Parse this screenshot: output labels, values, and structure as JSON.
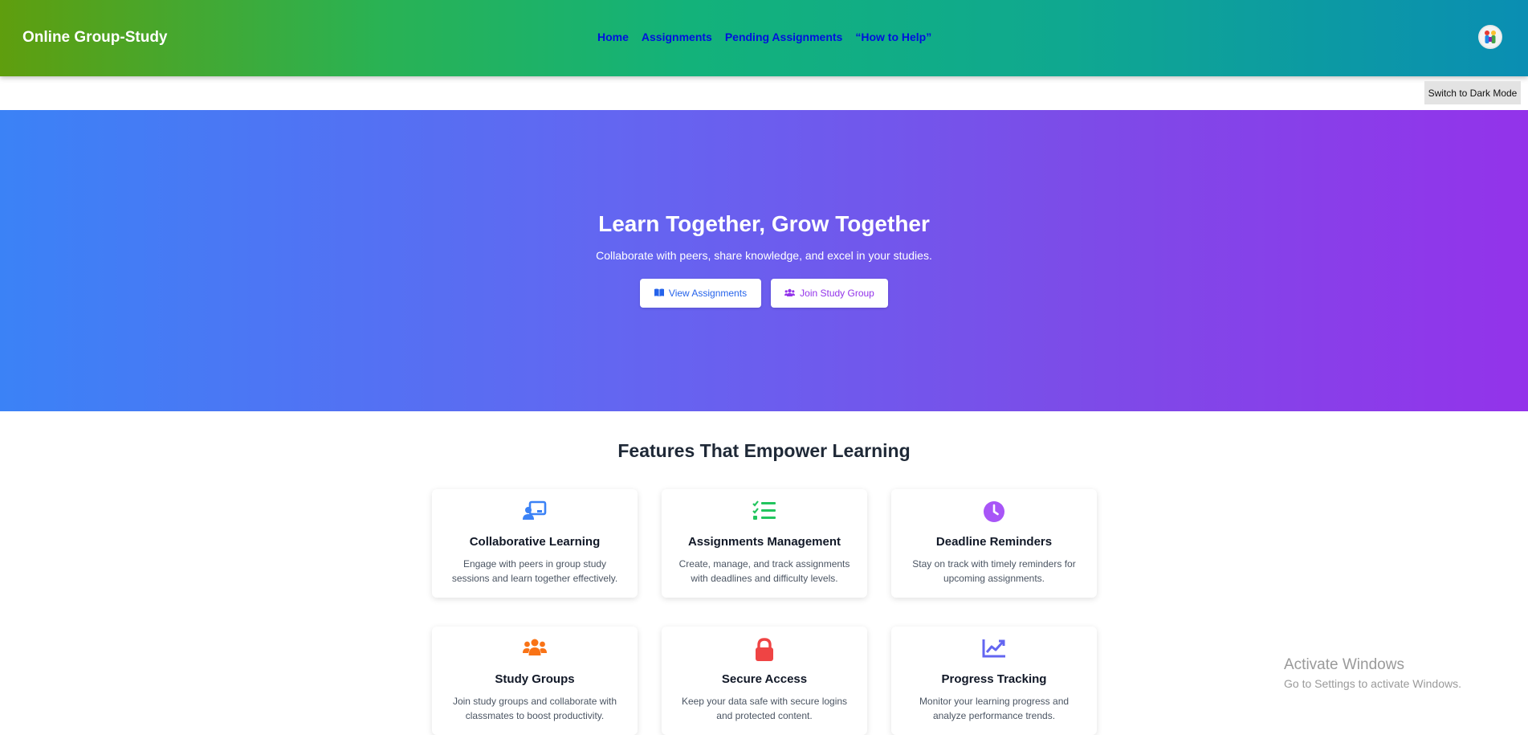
{
  "header": {
    "brand": "Online Group-Study",
    "nav": [
      "Home",
      "Assignments",
      "Pending Assignments",
      "“How to Help”"
    ],
    "avatar_icon": "user-avatar-icon"
  },
  "theme_toggle": {
    "label": "Switch to Dark Mode"
  },
  "hero": {
    "title": "Learn Together, Grow Together",
    "subtitle": "Collaborate with peers, share knowledge, and excel in your studies.",
    "buttons": [
      {
        "label": "View Assignments",
        "icon": "book-open-icon",
        "color": "#2563eb"
      },
      {
        "label": "Join Study Group",
        "icon": "users-icon",
        "color": "#9333ea"
      }
    ]
  },
  "features": {
    "title": "Features That Empower Learning",
    "cards": [
      {
        "title": "Collaborative Learning",
        "desc": "Engage with peers in group study sessions and learn together effectively.",
        "icon": "chalkboard-teacher-icon",
        "color": "#3b82f6"
      },
      {
        "title": "Assignments Management",
        "desc": "Create, manage, and track assignments with deadlines and difficulty levels.",
        "icon": "list-check-icon",
        "color": "#22c55e"
      },
      {
        "title": "Deadline Reminders",
        "desc": "Stay on track with timely reminders for upcoming assignments.",
        "icon": "clock-icon",
        "color": "#a855f7"
      },
      {
        "title": "Study Groups",
        "desc": "Join study groups and collaborate with classmates to boost productivity.",
        "icon": "users-icon",
        "color": "#f97316"
      },
      {
        "title": "Secure Access",
        "desc": "Keep your data safe with secure logins and protected content.",
        "icon": "lock-icon",
        "color": "#ef4444"
      },
      {
        "title": "Progress Tracking",
        "desc": "Monitor your learning progress and analyze performance trends.",
        "icon": "chart-line-icon",
        "color": "#6366f1"
      }
    ]
  },
  "watermark": {
    "line1": "Activate Windows",
    "line2": "Go to Settings to activate Windows."
  }
}
